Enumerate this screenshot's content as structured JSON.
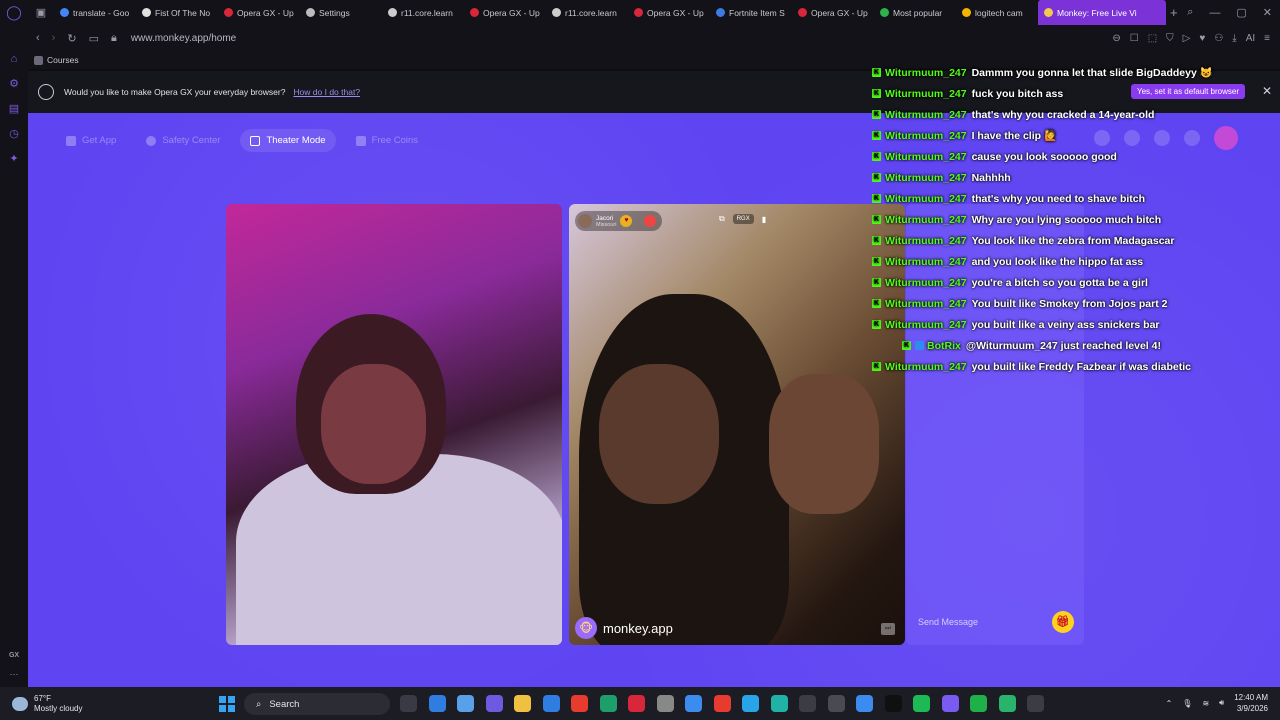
{
  "browser": {
    "tabs": [
      {
        "label": "translate - Goo",
        "color": "#4285f4"
      },
      {
        "label": "Fist Of The No",
        "color": "#e0e0e0"
      },
      {
        "label": "Opera GX - Up",
        "color": "#d8263b"
      },
      {
        "label": "Settings",
        "color": "#bbbbbb"
      },
      {
        "label": "r11.core.learn",
        "color": "#cccccc"
      },
      {
        "label": "Opera GX - Up",
        "color": "#d8263b"
      },
      {
        "label": "r11.core.learn",
        "color": "#cccccc"
      },
      {
        "label": "Opera GX - Up",
        "color": "#d8263b"
      },
      {
        "label": "Fortnite Item S",
        "color": "#3d7be0"
      },
      {
        "label": "Opera GX - Up",
        "color": "#d8263b"
      },
      {
        "label": "Most popular",
        "color": "#2bb24c"
      },
      {
        "label": "logitech cam",
        "color": "#f4b400"
      },
      {
        "label": "Monkey: Free Live Vi",
        "color": "#f2c94c",
        "active": true
      }
    ],
    "url": "www.monkey.app/home",
    "bookmark": "Courses",
    "tool_ai": "AI"
  },
  "infobar": {
    "message": "Would you like to make Opera GX your everyday browser?",
    "link": "How do I do that?",
    "default_button": "Yes, set it as default browser",
    "close": "✕"
  },
  "monkey": {
    "nav": [
      "Get App",
      "Safety Center",
      "Theater Mode",
      "Free Coins"
    ],
    "active_nav": "Theater Mode",
    "remote_user": {
      "name": "Jacori",
      "location": "Missouri"
    },
    "report_label": "RGX",
    "brand": "monkey.app",
    "send_placeholder": "Send Message"
  },
  "stream_chat": [
    {
      "user": "Witurmuum_247",
      "text": "Dammm you gonna let that slide BigDaddeyy 😺"
    },
    {
      "user": "Witurmuum_247",
      "text": "fuck you bitch ass"
    },
    {
      "user": "Witurmuum_247",
      "text": "that's why you cracked a 14-year-old"
    },
    {
      "user": "Witurmuum_247",
      "text": "I have the clip 🙋"
    },
    {
      "user": "Witurmuum_247",
      "text": "cause you look sooooo good"
    },
    {
      "user": "Witurmuum_247",
      "text": "Nahhhh"
    },
    {
      "user": "Witurmuum_247",
      "text": "that's why you need to shave bitch"
    },
    {
      "user": "Witurmuum_247",
      "text": "Why are you lying sooooo much bitch"
    },
    {
      "user": "Witurmuum_247",
      "text": "You look like the zebra from Madagascar"
    },
    {
      "user": "Witurmuum_247",
      "text": "and you look like the hippo fat ass"
    },
    {
      "user": "Witurmuum_247",
      "text": "you're a bitch so you gotta be a girl"
    },
    {
      "user": "Witurmuum_247",
      "text": "You built like Smokey from Jojos part 2"
    },
    {
      "user": "Witurmuum_247",
      "text": "you built like a veiny ass snickers bar"
    },
    {
      "user": "BotRix",
      "text": "@Witurmuum_247 just reached level 4!",
      "bot": true
    },
    {
      "user": "Witurmuum_247",
      "text": "you built like Freddy Fazbear if was diabetic"
    }
  ],
  "taskbar": {
    "temp": "67°F",
    "weather": "Mostly cloudy",
    "search": "Search",
    "time": "12:40 AM",
    "date": "3/9/2026",
    "app_colors": [
      "#3a3a44",
      "#2f7de1",
      "#5aa0e8",
      "#6e5ae0",
      "#f0c040",
      "#2f7de1",
      "#e63b2e",
      "#1e9e6b",
      "#d8263b",
      "#888888",
      "#3c8cf0",
      "#e63b2e",
      "#2aa4e8",
      "#20b2a6",
      "#3c3c44",
      "#4a4a55",
      "#3c8cf0",
      "#101010",
      "#1db954",
      "#7a5af0",
      "#20b04a",
      "#2ab36b",
      "#3c3c44"
    ]
  },
  "sidebar_gx": "GX"
}
